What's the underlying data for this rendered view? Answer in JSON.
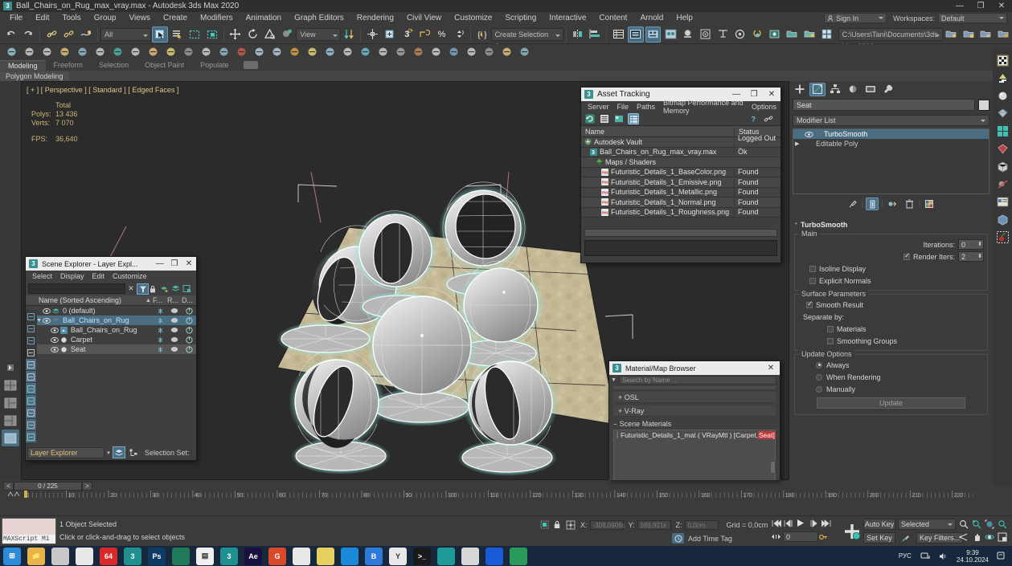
{
  "window": {
    "title": "Ball_Chairs_on_Rug_max_vray.max - Autodesk 3ds Max 2020",
    "app_badge": "3",
    "minimize": "—",
    "maximize": "❐",
    "close": "✕"
  },
  "menubar": {
    "items": [
      "File",
      "Edit",
      "Tools",
      "Group",
      "Views",
      "Create",
      "Modifiers",
      "Animation",
      "Graph Editors",
      "Rendering",
      "Civil View",
      "Customize",
      "Scripting",
      "Interactive",
      "Content",
      "Arnold",
      "Help"
    ]
  },
  "account": {
    "sign_in": "Sign In",
    "workspaces_label": "Workspaces:",
    "workspace_value": "Default"
  },
  "toolbar": {
    "selection_filter": "All",
    "reference_coord": "View",
    "selection_set": "Create Selection Se",
    "project_path": "C:\\Users\\Tani\\Documents\\3ds Max 2020"
  },
  "ribbon": {
    "tabs": [
      "Modeling",
      "Freeform",
      "Selection",
      "Object Paint",
      "Populate"
    ],
    "active_tab": "Modeling",
    "panel": "Polygon Modeling"
  },
  "viewport": {
    "label": "[ + ] [ Perspective ] [ Standard ] [ Edged Faces ]",
    "stats": {
      "header": "Total",
      "polys_label": "Polys:",
      "polys_value": "13 436",
      "verts_label": "Verts:",
      "verts_value": "7 070",
      "fps_label": "FPS:",
      "fps_value": "36,640"
    }
  },
  "asset_tracking": {
    "title": "Asset Tracking",
    "menu": [
      "Server",
      "File",
      "Paths",
      "Bitmap Performance and Memory",
      "Options"
    ],
    "columns": [
      "Name",
      "Status"
    ],
    "rows": [
      {
        "indent": 0,
        "icon": "vault-icon",
        "name": "Autodesk Vault",
        "status": "Logged Out .."
      },
      {
        "indent": 1,
        "icon": "max-file-icon",
        "name": "Ball_Chairs_on_Rug_max_vray.max",
        "status": "Ok"
      },
      {
        "indent": 2,
        "icon": "maps-shaders-icon",
        "name": "Maps / Shaders",
        "status": ""
      },
      {
        "indent": 3,
        "icon": "png-icon",
        "name": "Futuristic_Details_1_BaseColor.png",
        "status": "Found"
      },
      {
        "indent": 3,
        "icon": "png-icon",
        "name": "Futuristic_Details_1_Emissive.png",
        "status": "Found"
      },
      {
        "indent": 3,
        "icon": "png-icon",
        "name": "Futuristic_Details_1_Metallic.png",
        "status": "Found"
      },
      {
        "indent": 3,
        "icon": "png-icon",
        "name": "Futuristic_Details_1_Normal.png",
        "status": "Found"
      },
      {
        "indent": 3,
        "icon": "png-icon",
        "name": "Futuristic_Details_1_Roughness.png",
        "status": "Found"
      }
    ]
  },
  "scene_explorer": {
    "title": "Scene Explorer - Layer Expl...",
    "menu": [
      "Select",
      "Display",
      "Edit",
      "Customize"
    ],
    "search_value": "",
    "column_header": "Name (Sorted Ascending)",
    "col_f": "F...",
    "col_r": "R...",
    "col_d": "D...",
    "rows": [
      {
        "indent": 1,
        "name": "0 (default)",
        "type": "layer",
        "selected": false
      },
      {
        "indent": 1,
        "name": "Ball_Chairs_on_Rug",
        "type": "layer",
        "selected": true
      },
      {
        "indent": 2,
        "name": "Ball_Chairs_on_Rug",
        "type": "group",
        "selected": false
      },
      {
        "indent": 2,
        "name": "Carpet",
        "type": "object",
        "selected": false
      },
      {
        "indent": 2,
        "name": "Seat",
        "type": "object",
        "selected": false,
        "highlight": true
      }
    ],
    "mode_value": "Layer Explorer",
    "selection_set_label": "Selection Set:"
  },
  "material_browser": {
    "title": "Material/Map Browser",
    "search_placeholder": "Search by Name ...",
    "groups": [
      "+ OSL",
      "+ V-Ray"
    ],
    "scene_materials_label": "Scene Materials",
    "material_name": "Futuristic_Details_1_mat  ( VRayMtl )  [Carpet,",
    "material_tail": "Seat]"
  },
  "command_panel": {
    "object_name": "Seat",
    "modifier_list_label": "Modifier List",
    "stack": [
      {
        "name": "TurboSmooth",
        "selected": true,
        "eye": true
      },
      {
        "name": "Editable Poly",
        "selected": false,
        "expandable": true
      }
    ],
    "rollout_title": "TurboSmooth",
    "main_group": "Main",
    "iterations_label": "Iterations:",
    "iterations_value": "0",
    "render_iters_label": "Render Iters:",
    "render_iters_value": "2",
    "render_iters_checked": true,
    "isoline_label": "Isoline Display",
    "explicit_normals_label": "Explicit Normals",
    "surface_group": "Surface Parameters",
    "smooth_result_label": "Smooth Result",
    "smooth_result_checked": true,
    "separate_by_label": "Separate by:",
    "materials_label": "Materials",
    "smoothing_groups_label": "Smoothing Groups",
    "update_group": "Update Options",
    "update_always": "Always",
    "update_when_rendering": "When Rendering",
    "update_manually": "Manually",
    "update_selected": "Always",
    "update_button": "Update"
  },
  "timeline": {
    "prev": "<",
    "next": ">",
    "frame_display": "0 / 225",
    "ticks": [
      "0",
      "10",
      "20",
      "30",
      "40",
      "50",
      "60",
      "70",
      "80",
      "90",
      "100",
      "110",
      "120",
      "130",
      "140",
      "150",
      "160",
      "170",
      "180",
      "190",
      "200",
      "210",
      "220"
    ]
  },
  "statusbar": {
    "maxscript_label": "MAXScript Mi",
    "selection_info": "1 Object Selected",
    "prompt": "Click or click-and-drag to select objects",
    "x_label": "X:",
    "x_value": "-308,0908c",
    "y_label": "Y:",
    "y_value": "569,921к",
    "z_label": "Z:",
    "z_value": "0,0cm",
    "grid_label": "Grid = 0,0cm",
    "add_time_tag": "Add Time Tag",
    "auto_key": "Auto Key",
    "set_key": "Set Key",
    "key_mode_value": "Selected",
    "key_filters": "Key Filters...",
    "key_frame_value": "0"
  },
  "taskbar": {
    "icons": [
      "start-icon",
      "file-explorer-icon",
      "app-icon",
      "chrome-icon",
      "64-icon",
      "3dsmax-icon",
      "photoshop-icon",
      "app2-icon",
      "notepad-icon",
      "3dsmax2-icon",
      "aftereffects-icon",
      "g-icon",
      "opera-icon",
      "notes-icon",
      "edge-icon",
      "b-icon",
      "yandex-icon",
      "terminal-icon",
      "teal-icon",
      "calc-icon",
      "blue-icon",
      "green-icon"
    ],
    "language": "РУС",
    "time": "9:39",
    "date": "24.10.2024"
  },
  "colors": {
    "accent": "#4a6d82",
    "selection_highlight": "#8ce8e0",
    "carpet": "#c9bd9a",
    "taskbar": "#17283d",
    "title_text": "#c8b678"
  }
}
